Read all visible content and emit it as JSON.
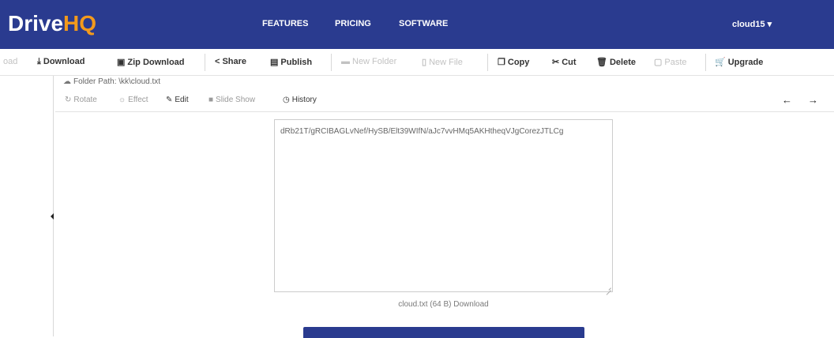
{
  "header": {
    "logo_main": "Drive",
    "logo_accent": "HQ",
    "nav": [
      "FEATURES",
      "PRICING",
      "SOFTWARE"
    ],
    "user": "cloud15 ▾",
    "colors": {
      "bar": "#2a3b8f",
      "accent": "#f39a1c"
    }
  },
  "toolbar": {
    "load": "oad",
    "download": "Download",
    "zip_download": "Zip Download",
    "share": "Share",
    "publish": "Publish",
    "new_folder": "New Folder",
    "new_file": "New File",
    "copy": "Copy",
    "cut": "Cut",
    "delete": "Delete",
    "paste": "Paste",
    "upgrade": "Upgrade"
  },
  "path": {
    "label": "Folder Path: \\kk\\cloud.txt"
  },
  "viewer": {
    "rotate": "Rotate",
    "effect": "Effect",
    "edit": "Edit",
    "slideshow": "Slide Show",
    "history": "History"
  },
  "file": {
    "content": "dRb21T/gRCIBAGLvNef/HySB/Elt39WIfN/aJc7vvHMq5AKHtheqVJgCorezJTLCg",
    "info": "cloud.txt (64 B) Download"
  }
}
